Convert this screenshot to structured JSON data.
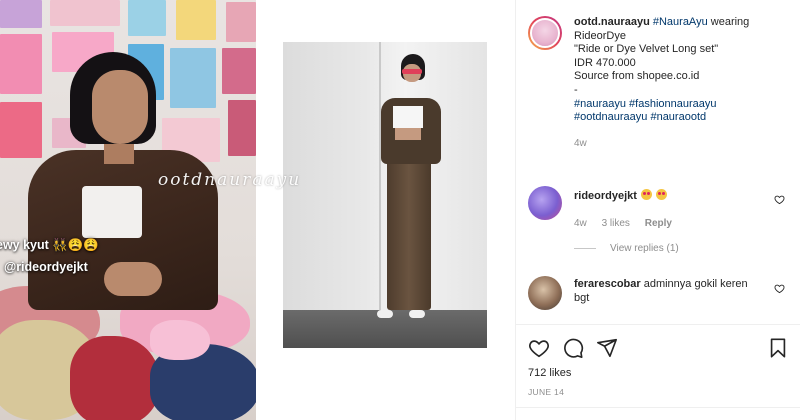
{
  "post": {
    "media": {
      "overlay_line1": "ewy kyut 👯‍♀️😩😩",
      "overlay_line2": "@rideordyejkt",
      "watermark": "ootdnauraayu"
    },
    "author": {
      "username": "ootd.nauraayu",
      "avatar_icon": "profile-avatar-icon"
    },
    "caption": {
      "hashtag_inline": "#NauraAyu",
      "line1_rest": " wearing",
      "line2": "RideorDye",
      "line3": "\"Ride or Dye Velvet Long set\"",
      "line4": "IDR 470.000",
      "line5": "Source from shopee.co.id",
      "line6": "-",
      "hashtags_line1": "#nauraayu #fashionnauraayu",
      "hashtags_line2": "#ootdnauraayu #nauraootd",
      "age": "4w"
    },
    "comments": [
      {
        "username": "rideordyejkt",
        "text": "",
        "age": "4w",
        "likes": "3 likes",
        "reply": "Reply",
        "view_replies": "View replies (1)"
      },
      {
        "username": "ferarescobar",
        "text": " adminnya gokil keren bgt"
      }
    ],
    "likes": "712 likes",
    "date": "JUNE 14"
  },
  "colors": {
    "link": "#00376b",
    "muted": "#8e8e8e",
    "text": "#262626"
  }
}
